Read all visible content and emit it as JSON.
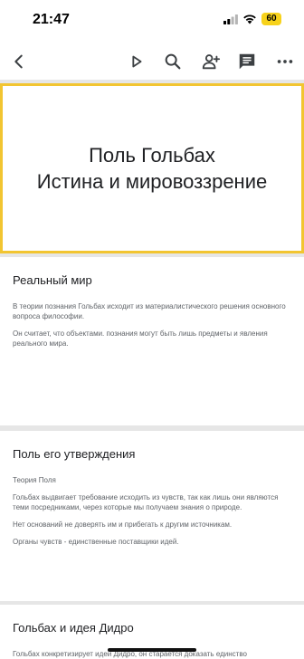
{
  "status_bar": {
    "time": "21:47",
    "battery": "60",
    "battery_color": "#f7d21b"
  },
  "toolbar": {
    "icons": [
      "back-arrow-icon",
      "play-icon",
      "search-icon",
      "add-person-icon",
      "comment-icon",
      "more-icon"
    ]
  },
  "accent_color": "#f2c531",
  "title_slide": {
    "line1": "Поль Гольбах",
    "line2": "Истина и мировоззрение"
  },
  "slides": [
    {
      "heading": "Реальный мир",
      "paragraphs": [
        "В теории познания Гольбах исходит из материалистического решения основного вопроса философии.",
        "Он считает, что объектами. познания могут быть лишь предметы и явления реального мира."
      ]
    },
    {
      "heading": "Поль  его утверждения",
      "paragraphs": [
        "Теория Поля",
        "Гольбах выдвигает требование исходить из чувств, так как лишь они являются теми посредниками, через которые мы получаем знания о природе.",
        "Нет оснований не доверять им и прибегать к другим источникам.",
        "Органы чувств - единственные поставщики идей."
      ]
    },
    {
      "heading": "Гольбах и идея Дидро",
      "paragraphs": [
        "Гольбах конкретизирует идеи Дидро, он старается доказать единство чувственного и рационального моментов в познании"
      ]
    }
  ]
}
